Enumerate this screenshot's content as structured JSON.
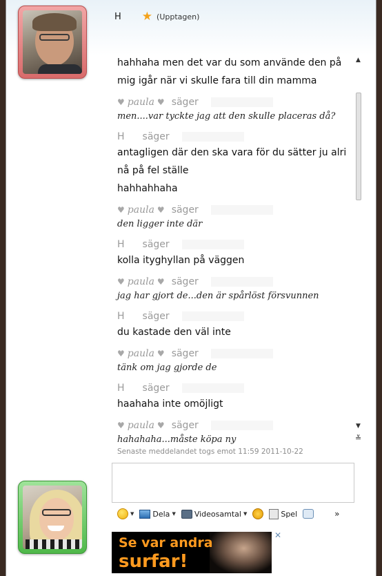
{
  "header": {
    "contact_name": "H",
    "status": "(Upptagen)",
    "star_icon": "star-icon"
  },
  "conversation": [
    {
      "sender": "",
      "style": "h",
      "lines": [
        "hahhaha men det var du som använde den på mig igår när vi skulle fara till din mamma"
      ]
    },
    {
      "sender": "paula",
      "style": "p",
      "lines": [
        "men....var tyckte jag att den skulle placeras då?"
      ]
    },
    {
      "sender": "H",
      "style": "h",
      "lines": [
        "antagligen där den ska vara för du sätter ju alri nå på fel ställe",
        "hahhahhaha"
      ]
    },
    {
      "sender": "paula",
      "style": "p",
      "lines": [
        "den ligger inte där"
      ]
    },
    {
      "sender": "H",
      "style": "h",
      "lines": [
        "kolla ityghyllan på väggen"
      ]
    },
    {
      "sender": "paula",
      "style": "p",
      "lines": [
        "jag har gjort de...den är spårlöst försvunnen"
      ]
    },
    {
      "sender": "H",
      "style": "h",
      "lines": [
        "du kastade den väl inte"
      ]
    },
    {
      "sender": "paula",
      "style": "p",
      "lines": [
        "tänk om jag gjorde de"
      ]
    },
    {
      "sender": "H",
      "style": "h",
      "lines": [
        "haahaha inte omöjligt"
      ]
    },
    {
      "sender": "paula",
      "style": "p",
      "lines": [
        "hahahaha...måste köpa ny"
      ]
    }
  ],
  "labels": {
    "says": "säger",
    "paula_name": "paula"
  },
  "timestamp": "Senaste meddelandet togs emot 11:59 2011-10-22",
  "toolbar": {
    "share": "Dela",
    "video_call": "Videosamtal",
    "games": "Spel",
    "more": "»"
  },
  "ad": {
    "line1": "Se var andra",
    "line2": "surfar!",
    "close": "✕"
  },
  "scrollbar": {
    "up": "▲",
    "down": "▼",
    "end": "≚"
  },
  "colors": {
    "accent_star": "#f4a21a",
    "ad_text": "#ff9a1f",
    "top_frame": "#d86b6b",
    "bottom_frame": "#4fb84a"
  }
}
